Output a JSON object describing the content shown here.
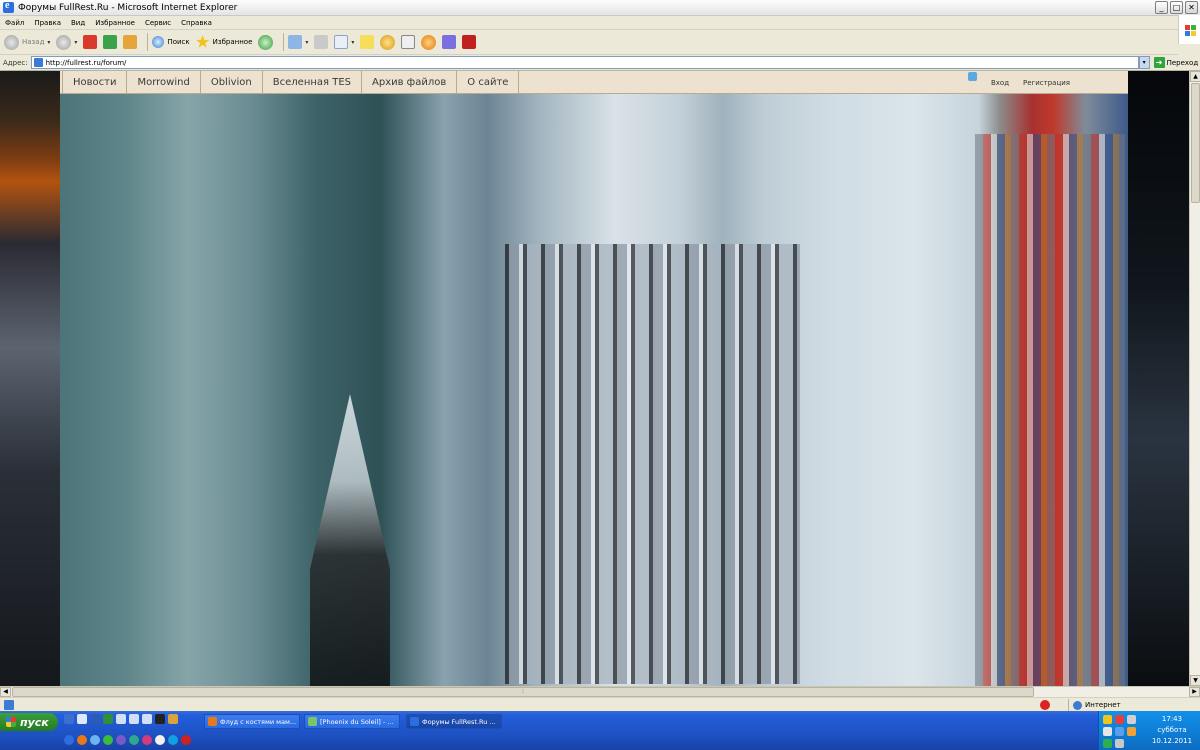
{
  "window": {
    "title": "Форумы FullRest.Ru - Microsoft Internet Explorer",
    "controls": [
      "_",
      "□",
      "✕"
    ]
  },
  "menu": [
    "Файл",
    "Правка",
    "Вид",
    "Избранное",
    "Сервис",
    "Справка"
  ],
  "toolbar": {
    "back_label": "Назад",
    "search_label": "Поиск",
    "favorites_label": "Избранное"
  },
  "address": {
    "label": "Адрес:",
    "url": "http://fullrest.ru/forum/",
    "go_label": "Переход"
  },
  "site": {
    "nav": [
      "Новости",
      "Morrowind",
      "Oblivion",
      "Вселенная TES",
      "Архив файлов",
      "О сайте"
    ],
    "login": "Вход",
    "register": "Регистрация"
  },
  "status": {
    "zone": "Интернет"
  },
  "taskbar": {
    "start_label": "пуск",
    "tasks": [
      "Флуд с костями мам...",
      "[Phoenix du Soleil] - ...",
      "Форумы FullRest.Ru ..."
    ],
    "clock_time": "17:43",
    "clock_day": "суббота",
    "clock_date": "10.12.2011"
  },
  "colors": {
    "xp_blue": "#245edb",
    "start_green": "#2d8a2d",
    "nav_bg": "#ece2cf",
    "chrome": "#ece9d8"
  }
}
